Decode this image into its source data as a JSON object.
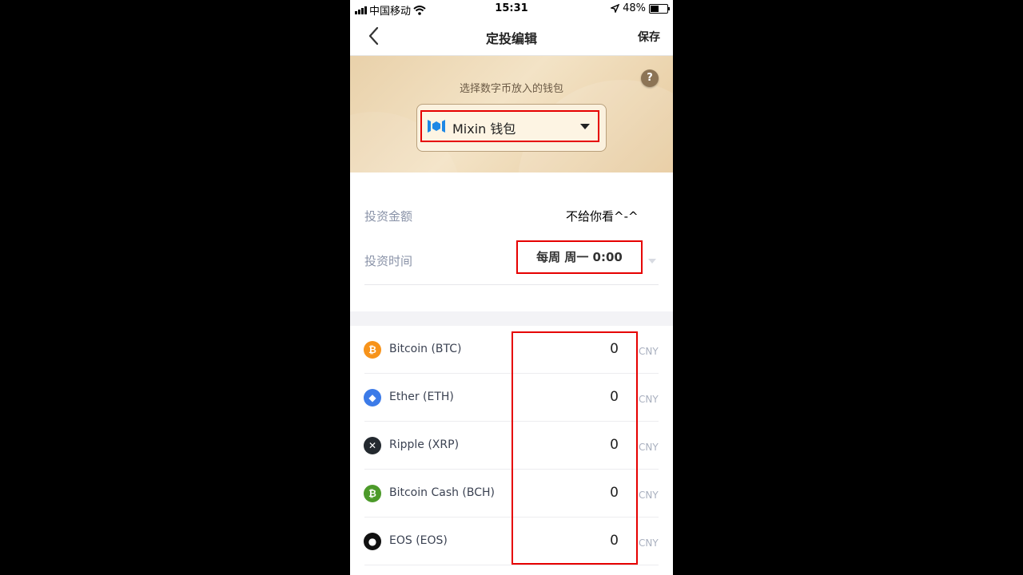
{
  "status_bar": {
    "carrier": "中国移动",
    "time": "15:31",
    "battery_percent": "48%",
    "battery_level": 0.48
  },
  "navbar": {
    "title": "定投编辑",
    "save_label": "保存",
    "back_icon": "chevron-left-icon"
  },
  "wallet": {
    "label": "选择数字币放入的钱包",
    "help": "?",
    "selected": "Mixin 钱包",
    "icon": "mixin-logo-icon"
  },
  "settings": {
    "amount_label": "投资金额",
    "amount_value": "不给你看^-^",
    "time_label": "投资时间",
    "time_value": "每周 周一 0:00"
  },
  "coins": [
    {
      "name": "Bitcoin (BTC)",
      "amount": "0",
      "unit": "CNY",
      "icon": "bitcoin-icon",
      "symbol": "₿",
      "color": "#f7931a"
    },
    {
      "name": "Ether (ETH)",
      "amount": "0",
      "unit": "CNY",
      "icon": "ether-icon",
      "symbol": "◆",
      "color": "#3c7be8"
    },
    {
      "name": "Ripple (XRP)",
      "amount": "0",
      "unit": "CNY",
      "icon": "ripple-icon",
      "symbol": "✕",
      "color": "#23292f"
    },
    {
      "name": "Bitcoin Cash (BCH)",
      "amount": "0",
      "unit": "CNY",
      "icon": "bitcoin-cash-icon",
      "symbol": "₿",
      "color": "#4c9a2a"
    },
    {
      "name": "EOS (EOS)",
      "amount": "0",
      "unit": "CNY",
      "icon": "eos-icon",
      "symbol": "●",
      "color": "#111111"
    }
  ],
  "colors": {
    "highlight_border": "#e60000",
    "banner": "#ecd7b3",
    "label_gray": "#8a93a8"
  }
}
